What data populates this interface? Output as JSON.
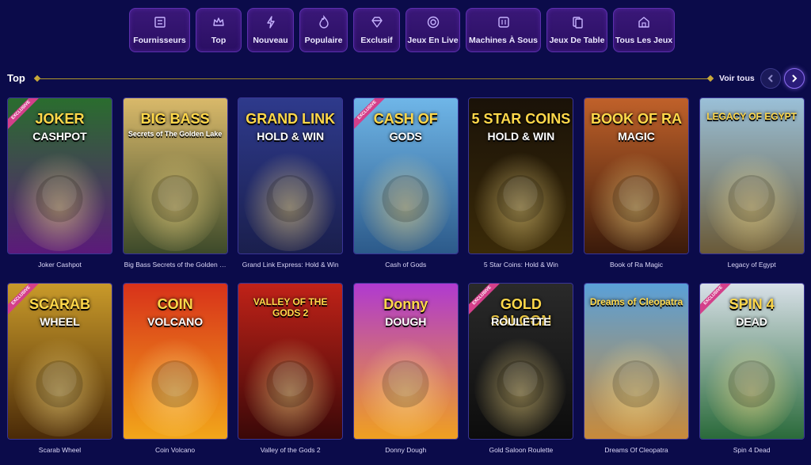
{
  "nav": {
    "categories": [
      {
        "label": "Fournisseurs",
        "icon": "providers-icon"
      },
      {
        "label": "Top",
        "icon": "crown-icon"
      },
      {
        "label": "Nouveau",
        "icon": "lightning-icon"
      },
      {
        "label": "Populaire",
        "icon": "flame-icon"
      },
      {
        "label": "Exclusif",
        "icon": "diamond-icon"
      },
      {
        "label": "Jeux En Live",
        "icon": "chip-icon"
      },
      {
        "label": "Machines À Sous",
        "icon": "slot-machine-icon"
      },
      {
        "label": "Jeux De Table",
        "icon": "cards-icon"
      },
      {
        "label": "Tous Les Jeux",
        "icon": "casino-building-icon"
      }
    ]
  },
  "section": {
    "title": "Top",
    "view_all": "Voir tous",
    "prev_icon": "chevron-left-icon",
    "next_icon": "chevron-right-icon"
  },
  "games": [
    {
      "name": "Joker Cashpot",
      "art": "JOKER",
      "art2": "CASHPOT",
      "exclusive": true,
      "badge": "EXCLUSIVE",
      "c1": "#2a6d2e",
      "c2": "#5b1a7a"
    },
    {
      "name": "Big Bass Secrets of the Golden L...",
      "art": "BIG BASS",
      "art2": "Secrets of The Golden Lake",
      "exclusive": false,
      "c1": "#d9b96a",
      "c2": "#3d4a2a"
    },
    {
      "name": "Grand Link Express: Hold & Win",
      "art": "GRAND LINK",
      "art2": "HOLD & WIN",
      "exclusive": false,
      "c1": "#2e3a8c",
      "c2": "#1a1f4d"
    },
    {
      "name": "Cash of Gods",
      "art": "CASH OF",
      "art2": "GODS",
      "exclusive": true,
      "badge": "EXCLUSIVE",
      "c1": "#6fb6e8",
      "c2": "#2c5a8a"
    },
    {
      "name": "5 Star Coins: Hold & Win",
      "art": "5 STAR COINS",
      "art2": "HOLD & WIN",
      "exclusive": false,
      "c1": "#1a1208",
      "c2": "#3a2a08"
    },
    {
      "name": "Book of Ra Magic",
      "art": "BOOK OF RA",
      "art2": "MAGIC",
      "exclusive": false,
      "c1": "#c0612a",
      "c2": "#3a1a0a"
    },
    {
      "name": "Legacy of Egypt",
      "art": "LEGACY OF EGYPT",
      "art2": "",
      "exclusive": false,
      "c1": "#9ac0d8",
      "c2": "#6a5a38"
    },
    {
      "name": "Scarab Wheel",
      "art": "SCARAB",
      "art2": "WHEEL",
      "exclusive": true,
      "badge": "EXCLUSIVE",
      "c1": "#c99a2a",
      "c2": "#4a2a08"
    },
    {
      "name": "Coin Volcano",
      "art": "COIN",
      "art2": "VOLCANO",
      "exclusive": false,
      "c1": "#d8321a",
      "c2": "#f2a61a"
    },
    {
      "name": "Valley of the Gods 2",
      "art": "VALLEY OF THE GODS 2",
      "art2": "",
      "exclusive": false,
      "c1": "#c02218",
      "c2": "#3a0808"
    },
    {
      "name": "Donny Dough",
      "art": "Donny",
      "art2": "DOUGH",
      "exclusive": false,
      "c1": "#b03ad0",
      "c2": "#f0a020"
    },
    {
      "name": "Gold Saloon Roulette",
      "art": "GOLD SALOON",
      "art2": "ROULETTE",
      "exclusive": true,
      "badge": "EXCLUSIVE",
      "c1": "#2a2a2a",
      "c2": "#0c0c0c"
    },
    {
      "name": "Dreams Of Cleopatra",
      "art": "Dreams of Cleopatra",
      "art2": "",
      "exclusive": false,
      "c1": "#5aa0d8",
      "c2": "#c88a3a"
    },
    {
      "name": "Spin 4 Dead",
      "art": "SPIN 4",
      "art2": "DEAD",
      "exclusive": true,
      "badge": "EXCLUSIVE",
      "c1": "#d8e0e8",
      "c2": "#2a6a3a"
    }
  ]
}
